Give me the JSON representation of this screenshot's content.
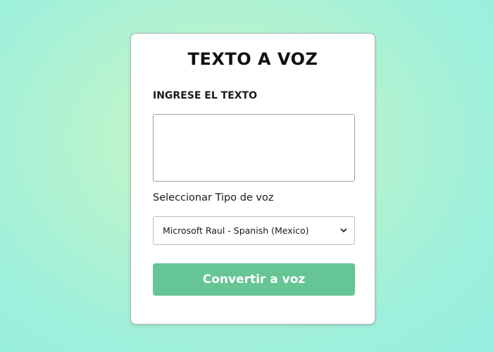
{
  "card": {
    "title": "TEXTO A VOZ",
    "text_label": "INGRESE EL TEXTO",
    "text_value": "",
    "voice_label": "Seleccionar Tipo de voz",
    "voice_selected": "Microsoft Raul - Spanish (Mexico)",
    "convert_button": "Convertir a voz"
  },
  "colors": {
    "accent": "#65c594",
    "background_center": "#c8f7c5",
    "background_edge": "#96eedf"
  },
  "icons": {
    "select_arrow": "chevron-down-icon"
  }
}
